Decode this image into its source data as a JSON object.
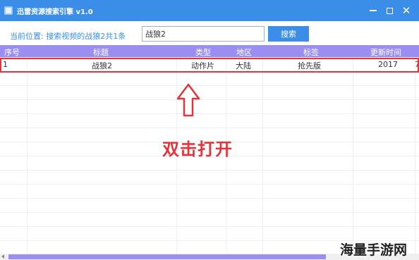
{
  "window": {
    "title": "迅雷资源搜索引擎 v1.0"
  },
  "search": {
    "location_label": "当前位置: 搜索视频的战狼2共1条",
    "query": "战狼2",
    "button_label": "搜索"
  },
  "table": {
    "columns": [
      "序号",
      "标题",
      "类型",
      "地区",
      "标签",
      "更新时间"
    ],
    "rows": [
      {
        "index": "1",
        "title": "战狼2",
        "type": "动作片",
        "region": "大陆",
        "tag": "抢先版",
        "updated": "2017",
        "extra": "7"
      }
    ]
  },
  "annotation": {
    "text": "双击打开"
  },
  "watermark": {
    "text": "海量手游网"
  },
  "colors": {
    "titlebar": "#3b8ee8",
    "header": "#9a8ef0",
    "highlight": "#e3343a"
  }
}
